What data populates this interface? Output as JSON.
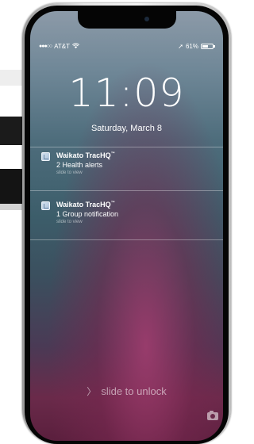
{
  "status_bar": {
    "signal_dots": "●●●○○",
    "carrier": "AT&T",
    "wifi_icon": "wifi-icon",
    "location_arrow": "➚",
    "battery_percent": "61%",
    "battery_level": 0.61
  },
  "lock_screen": {
    "time": "11:09",
    "date": "Saturday, March 8",
    "unlock_text": "slide to unlock",
    "unlock_chevron": "〉"
  },
  "notifications": [
    {
      "app": "Waikato TracHQ",
      "tm": "™",
      "body": "2 Health alerts",
      "action": "slide to view"
    },
    {
      "app": "Waikato TracHQ",
      "tm": "™",
      "body": "1 Group notification",
      "action": "slide to view"
    }
  ],
  "colors": {
    "screen_top": "#8c9aa8",
    "screen_mid": "#3c5d6a",
    "screen_bottom": "#5a1f3d"
  }
}
